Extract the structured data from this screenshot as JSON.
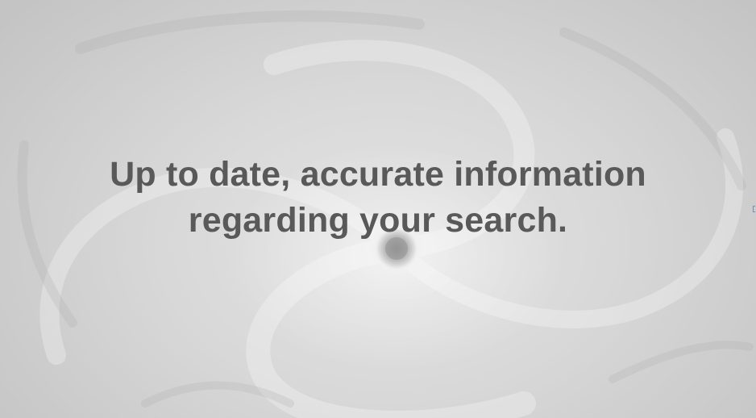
{
  "hero": {
    "background_image": "hurricane-eye-satellite-image",
    "headline_line1": "Up to date, accurate information",
    "headline_line2": "regarding your search."
  },
  "colors": {
    "headline_text": "#595959",
    "background": "#d9d9d9"
  }
}
